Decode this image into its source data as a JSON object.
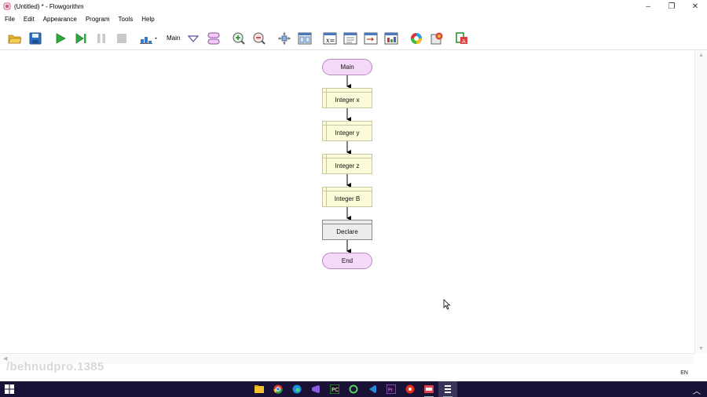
{
  "window": {
    "title": "(Untitled) * - Flowgorithm",
    "minimize": "–",
    "restore": "❐",
    "close": "✕"
  },
  "menu": [
    "File",
    "Edit",
    "Appearance",
    "Program",
    "Tools",
    "Help"
  ],
  "toolbar": {
    "function_label": "Main",
    "buttons": [
      "open-folder-icon",
      "save-icon",
      "run-icon",
      "step-icon",
      "pause-icon",
      "stop-icon",
      "speed-icon",
      "function-dropdown-icon",
      "manage-functions-icon",
      "zoom-in-icon",
      "zoom-out-icon",
      "fit-icon",
      "layout-icon",
      "variable-watch-icon",
      "console-icon",
      "output-icon",
      "chart-icon",
      "color-icon",
      "style-icon",
      "export-icon"
    ]
  },
  "flowchart": {
    "start": "Main",
    "declarations": [
      "Integer x",
      "Integer y",
      "Integer z",
      "Integer B"
    ],
    "current_shape": "Declare",
    "end": "End"
  },
  "watermark": "/behnudpro.1385",
  "tray": {
    "lang": "EN"
  },
  "taskbar": {
    "apps": [
      "file-explorer-icon",
      "chrome-icon",
      "edge-icon",
      "visual-studio-icon",
      "pycharm-icon",
      "app-icon",
      "vscode-icon",
      "premiere-icon",
      "acrobat-icon",
      "app2-icon",
      "flowgorithm-icon"
    ]
  },
  "colors": {
    "terminal_fill": "#f5d9f9",
    "declare_fill": "#fbfbd9",
    "taskbar": "#1a1236"
  }
}
